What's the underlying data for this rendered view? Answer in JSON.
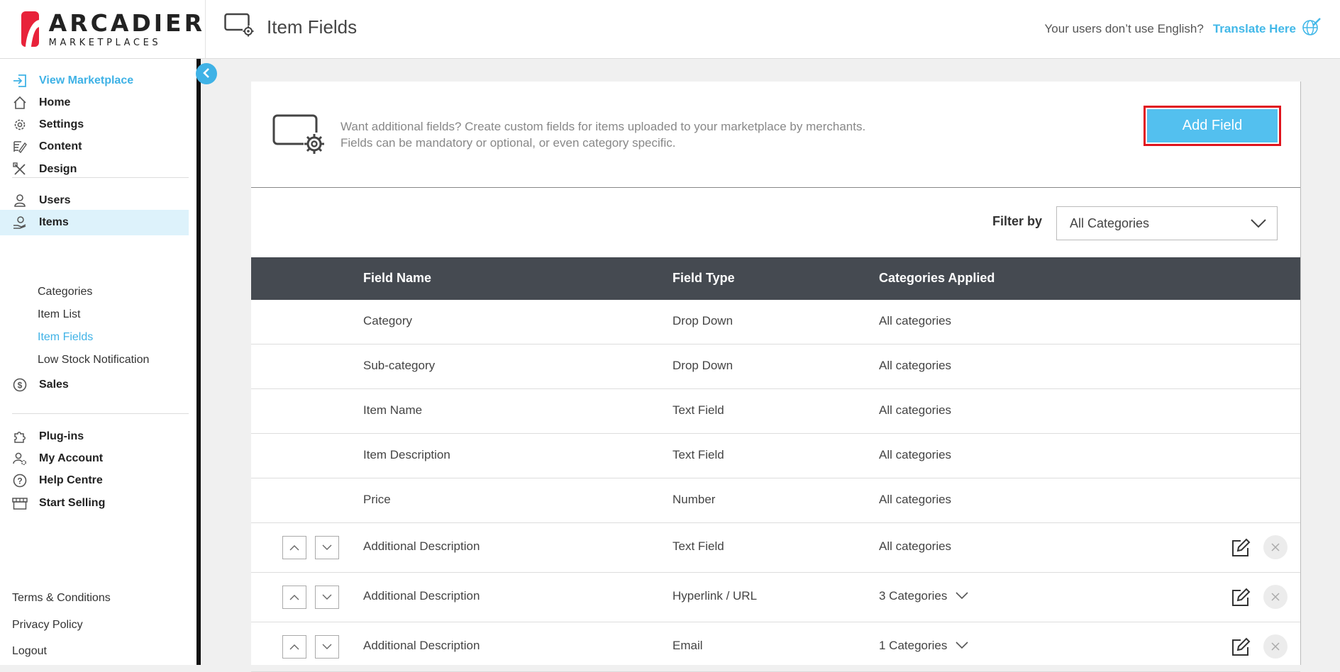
{
  "brand": {
    "name": "ARCADIER",
    "tagline": "MARKETPLACES",
    "color": "#e8223a"
  },
  "header": {
    "page_title": "Item Fields",
    "translate_question": "Your users don’t use English?",
    "translate_link": "Translate Here"
  },
  "sidebar": {
    "view_marketplace": "View Marketplace",
    "home": "Home",
    "settings": "Settings",
    "content": "Content",
    "design": "Design",
    "users": "Users",
    "items": "Items",
    "items_sub": {
      "categories": "Categories",
      "item_list": "Item List",
      "item_fields": "Item Fields",
      "low_stock": "Low Stock Notification"
    },
    "sales": "Sales",
    "plugins": "Plug-ins",
    "my_account": "My Account",
    "help_centre": "Help Centre",
    "start_selling": "Start Selling",
    "terms": "Terms & Conditions",
    "privacy": "Privacy Policy",
    "logout": "Logout"
  },
  "intro": {
    "line1": "Want additional fields? Create custom fields for items uploaded to your marketplace by merchants.",
    "line2": "Fields can be mandatory or optional, or even category specific.",
    "add_button": "Add Field"
  },
  "filter": {
    "label": "Filter by",
    "selected": "All Categories"
  },
  "table": {
    "headers": {
      "name": "Field Name",
      "type": "Field Type",
      "categories": "Categories Applied"
    },
    "rows": [
      {
        "name": "Category",
        "type": "Drop Down",
        "categories": "All categories"
      },
      {
        "name": "Sub-category",
        "type": "Drop Down",
        "categories": "All categories"
      },
      {
        "name": "Item Name",
        "type": "Text Field",
        "categories": "All categories"
      },
      {
        "name": "Item Description",
        "type": "Text Field",
        "categories": "All categories"
      },
      {
        "name": "Price",
        "type": "Number",
        "categories": "All categories"
      },
      {
        "name": "Additional Description",
        "type": "Text Field",
        "categories": "All categories"
      },
      {
        "name": "Additional Description",
        "type": "Hyperlink / URL",
        "categories": "3 Categories"
      },
      {
        "name": "Additional Description",
        "type": "Email",
        "categories": "1 Categories"
      }
    ]
  },
  "colors": {
    "accent": "#3fb2e6",
    "button": "#53c0ef",
    "table_header": "#454a51",
    "highlight_border": "#e0141e"
  }
}
